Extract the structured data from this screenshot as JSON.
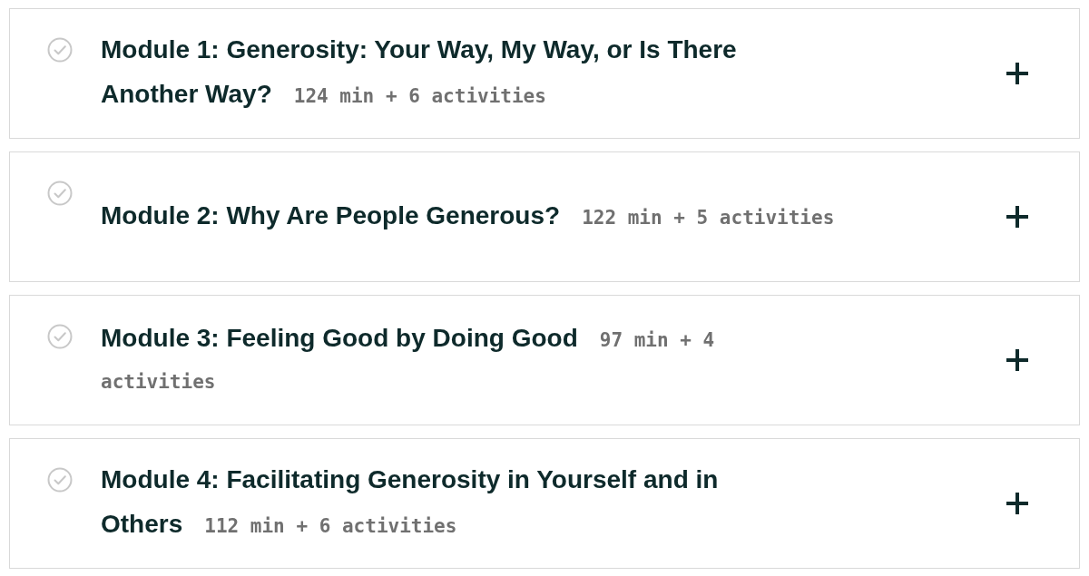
{
  "modules": [
    {
      "title": "Module 1: Generosity: Your Way, My Way, or Is There Another Way?",
      "meta": "124 min + 6 activities",
      "expanded": false
    },
    {
      "title": "Module 2: Why Are People Generous?",
      "meta": "122 min + 5 activities",
      "expanded": false
    },
    {
      "title": "Module 3: Feeling Good by Doing Good",
      "meta": "97 min + 4 activities",
      "expanded": false
    },
    {
      "title": "Module 4: Facilitating Generosity in Yourself and in Others",
      "meta": "112 min + 6 activities",
      "expanded": false
    }
  ]
}
